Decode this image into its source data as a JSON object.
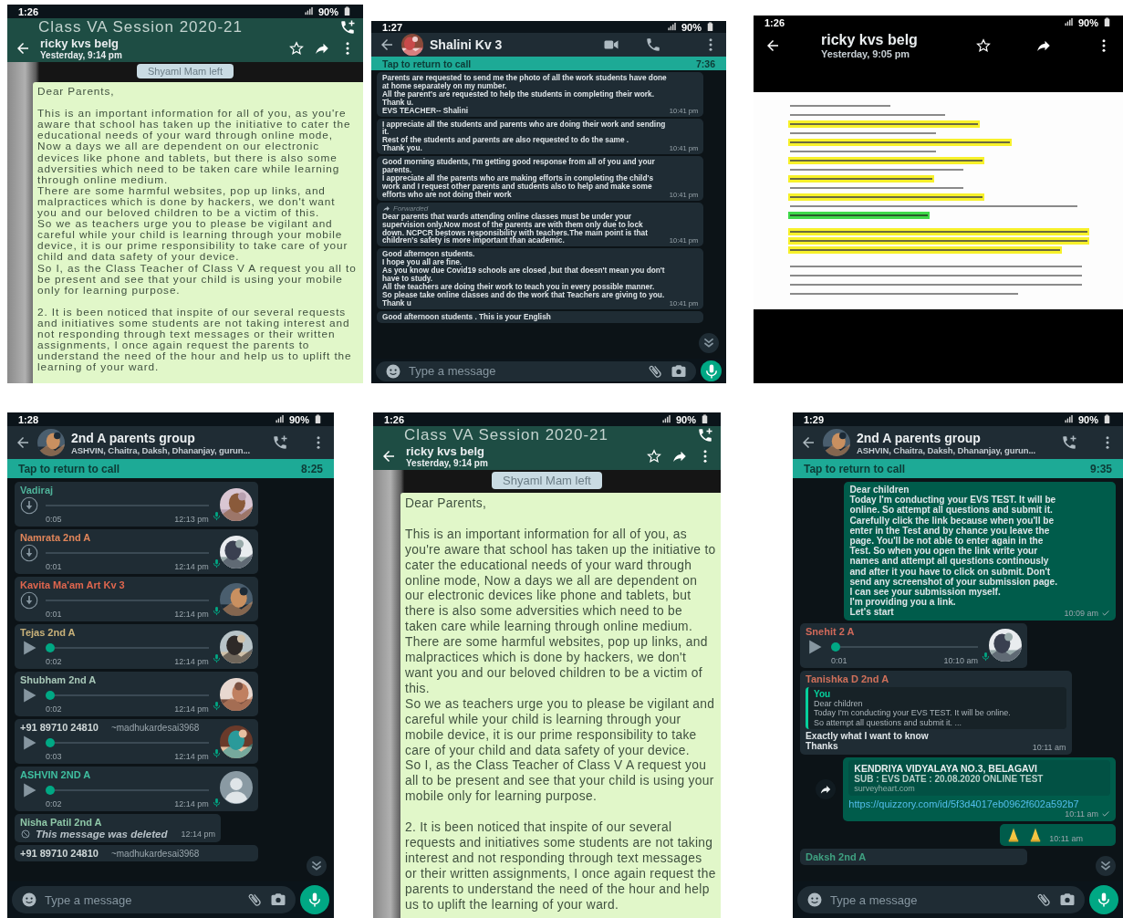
{
  "panels": [
    {
      "kind": "image_message",
      "status": {
        "time": "1:26",
        "battery": "90%"
      },
      "header": {
        "group_title": "Class VA Session 2020-21",
        "title": "ricky kvs belg",
        "subtitle": "Yesterday, 9:14 pm"
      },
      "system_note": "Shyaml Mam left",
      "note": "Dear Parents,\n\nThis is an important information for all of you, as you're aware that school has taken up the initiative to cater the educational needs of your ward through online mode, Now a days we all are dependent on our electronic devices like phone and tablets, but there is also some adversities which need to be taken care while learning through online medium.\nThere are some harmful websites, pop up links, and malpractices which is done by hackers, we don't want you and our beloved children to be a victim of this.\nSo we as teachers urge you to please be vigilant and careful while your child is learning through your mobile device, it is our prime responsibility to take care of your child and data safety of your device.\nSo I, as the Class Teacher of Class V A request you all to be present and see that your child is using your mobile only for learning purpose.\n\n2. It is been noticed that inspite of our several requests and initiatives some students are not taking interest and not responding through text messages or their written assignments, I once again request the parents to understand the need of the hour and help us to uplift the learning of your ward."
    },
    {
      "kind": "chat",
      "status": {
        "time": "1:27",
        "battery": "90%"
      },
      "header": {
        "title": "Shalini Kv 3"
      },
      "call_banner": {
        "label": "Tap to return to call",
        "duration": "7:36"
      },
      "messages": [
        {
          "kind": "text",
          "outgoing": false,
          "text": "Parents are requested to send me the photo of all the work students have done at home separately on my number.\nAll the parent's are requested to help the students in completing their work.\nThank u.\nEVS TEACHER-- Shalini",
          "time": "10:41 pm"
        },
        {
          "kind": "text",
          "outgoing": false,
          "text": "I appreciate all the students and parents who are doing their work and sending it.\nRest of the students and parents are also requested to do the same .\nThank you.",
          "time": "10:41 pm"
        },
        {
          "kind": "text",
          "outgoing": false,
          "text": "Good morning students, I'm getting good response from all of you and your parents.\nI appreciate all the parents who are making efforts in completing the child's work and I request other parents and students also to help and make some efforts who are not doing their work",
          "time": "10:41 pm"
        },
        {
          "kind": "text",
          "outgoing": false,
          "forwarded_label": "Forwarded",
          "text": "Dear parents that  wards attending online classes must be under your supervision only.Now most of the parents are with them only due to lock down. NCPCR bestows responsibility with teachers.The main point is that children's safety is more important than academic.",
          "time": "10:41 pm"
        },
        {
          "kind": "text",
          "outgoing": false,
          "text": "Good afternoon students.\nI hope you all are fine.\nAs you know due Covid19 schools are closed ,but that doesn't mean you don't have to study.\nAll the teachers are doing their work to teach you in every possible manner.\nSo please take online classes and do the work that Teachers are giving to you.\nThank u",
          "time": "10:41 pm"
        },
        {
          "kind": "text",
          "outgoing": false,
          "text": "Good afternoon students . This is your English"
        }
      ],
      "input": {
        "placeholder": "Type a message"
      }
    },
    {
      "kind": "image_viewer",
      "status": {
        "time": "1:26",
        "battery": "90%"
      },
      "header": {
        "title": "ricky kvs belg",
        "subtitle": "Yesterday, 9:05 pm"
      }
    },
    {
      "kind": "chat",
      "status": {
        "time": "1:28",
        "battery": "90%"
      },
      "header": {
        "title": "2nd A parents group",
        "subtitle": "ASHVIN, Chaitra, Daksh, Dhananjay, gurun..."
      },
      "call_banner": {
        "label": "Tap to return to call",
        "duration": "8:25"
      },
      "messages": [
        {
          "kind": "voice",
          "sender": "Vadiraj",
          "color": "#4fb39a",
          "downloaded": false,
          "duration": "0:05",
          "time": "12:13 pm",
          "has_photo": true
        },
        {
          "kind": "voice",
          "sender": "Namrata 2nd A",
          "color": "#e0855a",
          "downloaded": false,
          "duration": "0:01",
          "time": "12:14 pm",
          "has_photo": true
        },
        {
          "kind": "voice",
          "sender": "Kavita Ma'am Art Kv 3",
          "color": "#e0664e",
          "downloaded": false,
          "duration": "0:01",
          "time": "12:14 pm",
          "has_photo": true
        },
        {
          "kind": "voice",
          "sender": "Tejas 2nd A",
          "color": "#c9b27a",
          "downloaded": true,
          "duration": "0:02",
          "time": "12:14 pm",
          "has_photo": true
        },
        {
          "kind": "voice",
          "sender": "Shubham 2nd A",
          "color": "#a8c8b8",
          "downloaded": true,
          "duration": "0:02",
          "time": "12:14 pm",
          "has_photo": true
        },
        {
          "kind": "voice",
          "sender": "+91 89710 24810",
          "alias": "~madhukardesai3968",
          "color": "#d0d8d8",
          "downloaded": true,
          "duration": "0:03",
          "time": "12:14 pm",
          "has_photo": true
        },
        {
          "kind": "voice",
          "sender": "ASHVIN 2ND A",
          "color": "#3fbfa0",
          "downloaded": true,
          "duration": "0:02",
          "time": "12:14 pm",
          "has_photo": false
        },
        {
          "kind": "deleted",
          "sender": "Nisha Patil 2nd A",
          "color": "#8fc8a8",
          "text": "This message was deleted",
          "time": "12:14 pm"
        },
        {
          "kind": "cut",
          "sender": "+91 89710 24810",
          "alias": "~madhukardesai3968",
          "color": "#d0d8d8"
        }
      ],
      "input": {
        "placeholder": "Type a message"
      }
    },
    {
      "kind": "image_message",
      "status": {
        "time": "1:26",
        "battery": "90%"
      },
      "header": {
        "group_title": "Class VA Session 2020-21",
        "title": "ricky kvs belg",
        "subtitle": "Yesterday, 9:14 pm"
      },
      "system_note": "Shyaml Mam left",
      "note": "Dear Parents,\n\nThis is an important information for all of you, as you're aware that school has taken up the initiative to cater the educational needs of your ward through online mode, Now a days we all are dependent on our electronic devices like phone and tablets, but there is also some adversities which need to be taken care while learning through online medium.\nThere are some harmful websites, pop up links, and malpractices which is done by hackers, we don't want you and our beloved children to be a victim of this.\nSo we as teachers urge you to please be vigilant and careful while your child is learning through your mobile device, it is our prime responsibility to take care of your child and data safety of your device.\nSo I, as the Class Teacher of Class V A request you all to be present and see that your child is using your mobile only for learning purpose.\n\n2. It is been noticed that inspite of our several requests and initiatives some students are not taking interest and not responding through text messages or their written assignments, I once again request the parents to understand the need of the hour and help us to uplift the learning of your ward."
    },
    {
      "kind": "chat",
      "status": {
        "time": "1:29",
        "battery": "90%"
      },
      "header": {
        "title": "2nd A parents group",
        "subtitle": "ASHVIN, Chaitra, Daksh, Dhananjay, gurun..."
      },
      "call_banner": {
        "label": "Tap to return to call",
        "duration": "9:35"
      },
      "messages": [
        {
          "kind": "text",
          "outgoing": true,
          "text": "Dear children\nToday I'm conducting your EVS TEST. It will be online.  So attempt all questions and submit it. Carefully click the link because when you'll be enter in the Test and by chance you leave the page. You'll be not able to enter again  in the Test. So when you open the link write your names and attempt all questions continously and after it you have to click on submit. Don't send any screenshot of your submission page. I can see your submission myself.\nI'm providing you a link.\nLet's start",
          "time": "10:09 am"
        },
        {
          "kind": "voice",
          "sender": "Snehit 2 A",
          "color": "#d0695a",
          "downloaded": true,
          "duration": "0:01",
          "time": "10:10 am",
          "has_photo": true
        },
        {
          "kind": "reply",
          "sender": "Tanishka D 2nd A",
          "color": "#d0705a",
          "quote_author": "You",
          "quote_text": "Dear children\nToday I'm conducting your EVS TEST. It will be online.\nSo attempt all questions and submit it. ...",
          "text": "Exactly what I want to know\nThanks",
          "time": "10:11 am"
        },
        {
          "kind": "link",
          "outgoing": true,
          "title": "KENDRIYA VIDYALAYA NO.3, BELAGAVI",
          "description": "SUB : EVS DATE : 20.08.2020 ONLINE TEST",
          "domain": "surveyheart.com",
          "url": "https://quizzory.com/id/5f3d4017eb0962f602a592b7",
          "time": "10:11 am"
        },
        {
          "kind": "emoji",
          "outgoing": true,
          "time": "10:11 am"
        },
        {
          "kind": "cut",
          "sender": "Daksh 2nd A",
          "color": "#3fa080"
        }
      ],
      "input": {
        "placeholder": "Type a message"
      }
    }
  ]
}
